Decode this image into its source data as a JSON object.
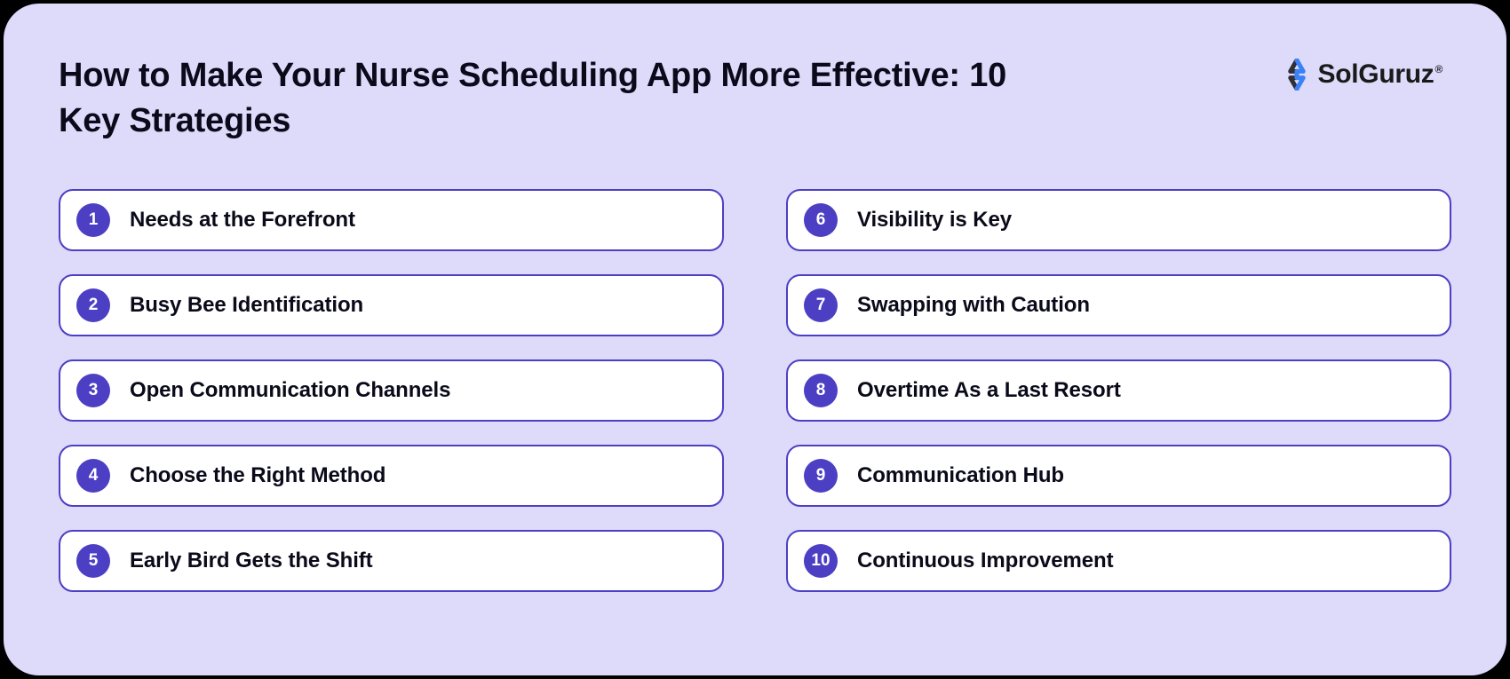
{
  "title": "How to Make Your Nurse Scheduling App More Effective: 10 Key Strategies",
  "brand": {
    "name": "SolGuruz",
    "registered": "®"
  },
  "strategies": {
    "left": [
      {
        "num": "1",
        "label": "Needs at the Forefront"
      },
      {
        "num": "2",
        "label": "Busy Bee Identification"
      },
      {
        "num": "3",
        "label": "Open Communication Channels"
      },
      {
        "num": "4",
        "label": "Choose the Right Method"
      },
      {
        "num": "5",
        "label": "Early Bird Gets the Shift"
      }
    ],
    "right": [
      {
        "num": "6",
        "label": "Visibility is Key"
      },
      {
        "num": "7",
        "label": "Swapping with Caution"
      },
      {
        "num": "8",
        "label": "Overtime As a Last Resort"
      },
      {
        "num": "9",
        "label": "Communication Hub"
      },
      {
        "num": "10",
        "label": "Continuous Improvement"
      }
    ]
  }
}
